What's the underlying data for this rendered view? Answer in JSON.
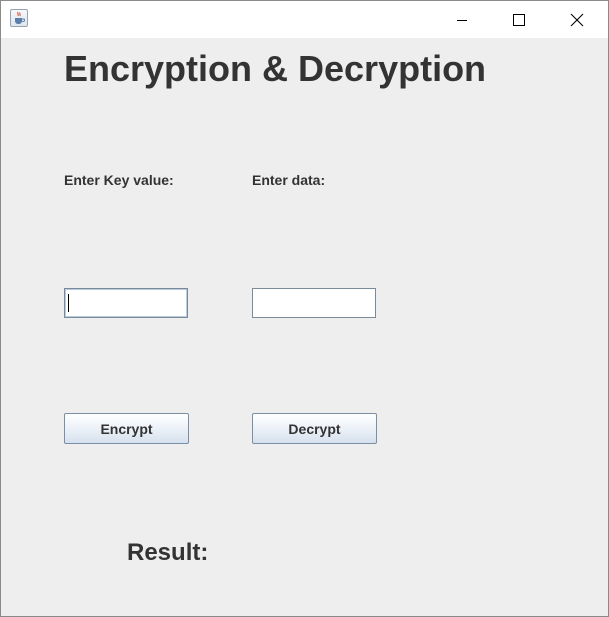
{
  "window": {
    "icon": "java-cup-icon",
    "controls": {
      "minimize": "minimize-icon",
      "maximize": "maximize-icon",
      "close": "close-icon"
    }
  },
  "main": {
    "heading": "Encryption & Decryption",
    "key_label": "Enter Key value:",
    "data_label": "Enter data:",
    "key_input_value": "",
    "data_input_value": "",
    "encrypt_label": "Encrypt",
    "decrypt_label": "Decrypt",
    "result_label": "Result:"
  }
}
